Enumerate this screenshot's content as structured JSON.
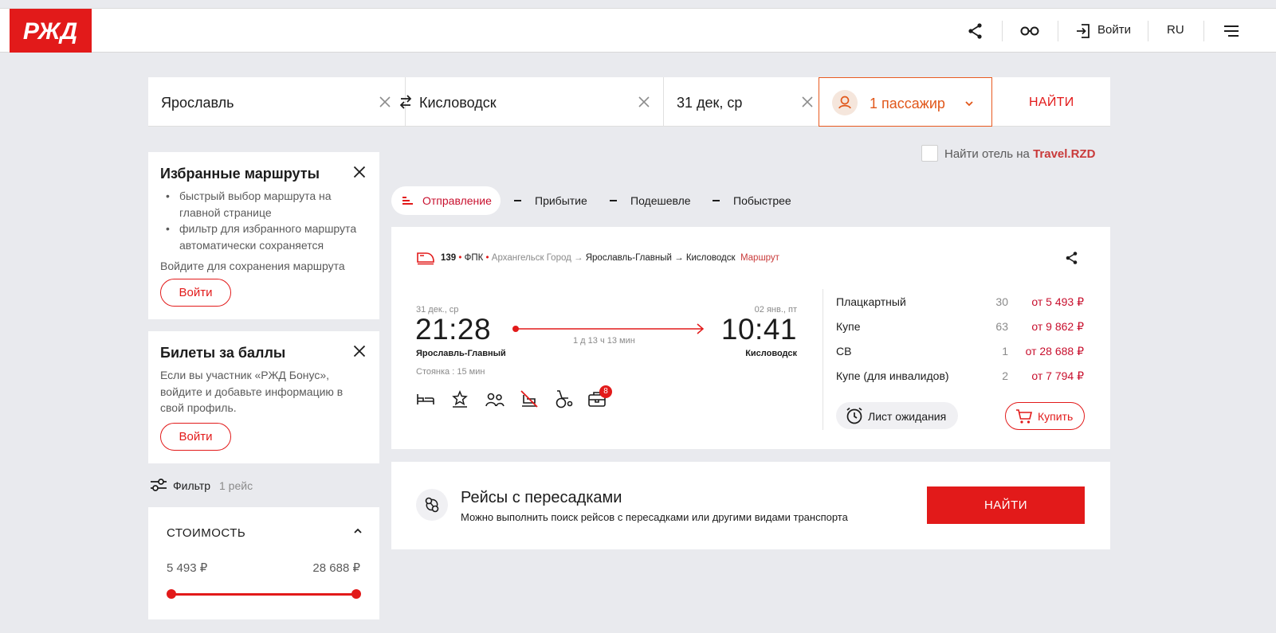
{
  "header": {
    "login_label": "Войти",
    "lang_label": "RU",
    "brand_color": "#e21a1a"
  },
  "search": {
    "from": "Ярославль",
    "to": "Кисловодск",
    "date": "31 дек, ср",
    "passengers": "1 пассажир",
    "find_label": "НАЙТИ"
  },
  "hotel": {
    "prefix": "Найти отель на ",
    "link": "Travel.RZD"
  },
  "favorites": {
    "title": "Избранные маршруты",
    "bullets": [
      [
        "быстрый выбор маршрута на",
        "главной странице"
      ],
      [
        "фильтр для избранного маршрута",
        "автоматически сохраняется"
      ]
    ],
    "note": "Войдите для сохранения маршрута",
    "button": "Войти"
  },
  "points": {
    "title": "Билеты за баллы",
    "lines": [
      "Если вы участник «РЖД Бонус»,",
      "войдите и добавьте информацию в",
      "свой профиль."
    ],
    "button": "Войти"
  },
  "filter": {
    "label": "Фильтр",
    "count": "1 рейс"
  },
  "cost": {
    "title": "СТОИМОСТЬ",
    "min": "5 493 ₽",
    "max": "28 688 ₽"
  },
  "sort": {
    "items": [
      "Отправление",
      "Прибытие",
      "Подешевле",
      "Побыстрее"
    ]
  },
  "train": {
    "number": "139",
    "carrier": "ФПК",
    "origin": "Архангельск Город",
    "station_from": "Ярославль-Главный",
    "station_to": "Кисловодск",
    "route_link": "Маршрут",
    "dep_date": "31 дек., ср",
    "arr_date": "02 янв., пт",
    "dep_time": "21:28",
    "arr_time": "10:41",
    "duration": "1 д 13 ч 13 мин",
    "stop": "Стоянка : 15 мин",
    "badge": "8",
    "classes": [
      {
        "name": "Плацкартный",
        "seats": "30",
        "price": "от 5 493 ₽"
      },
      {
        "name": "Купе",
        "seats": "63",
        "price": "от 9 862 ₽"
      },
      {
        "name": "СВ",
        "seats": "1",
        "price": "от 28 688 ₽"
      },
      {
        "name": "Купе (для инвалидов)",
        "seats": "2",
        "price": "от 7 794 ₽"
      }
    ],
    "waitlist": "Лист ожидания",
    "buy": "Купить"
  },
  "transfers": {
    "title": "Рейсы с пересадками",
    "subtitle": "Можно выполнить поиск рейсов с пересадками или другими видами транспорта",
    "button": "НАЙТИ"
  }
}
